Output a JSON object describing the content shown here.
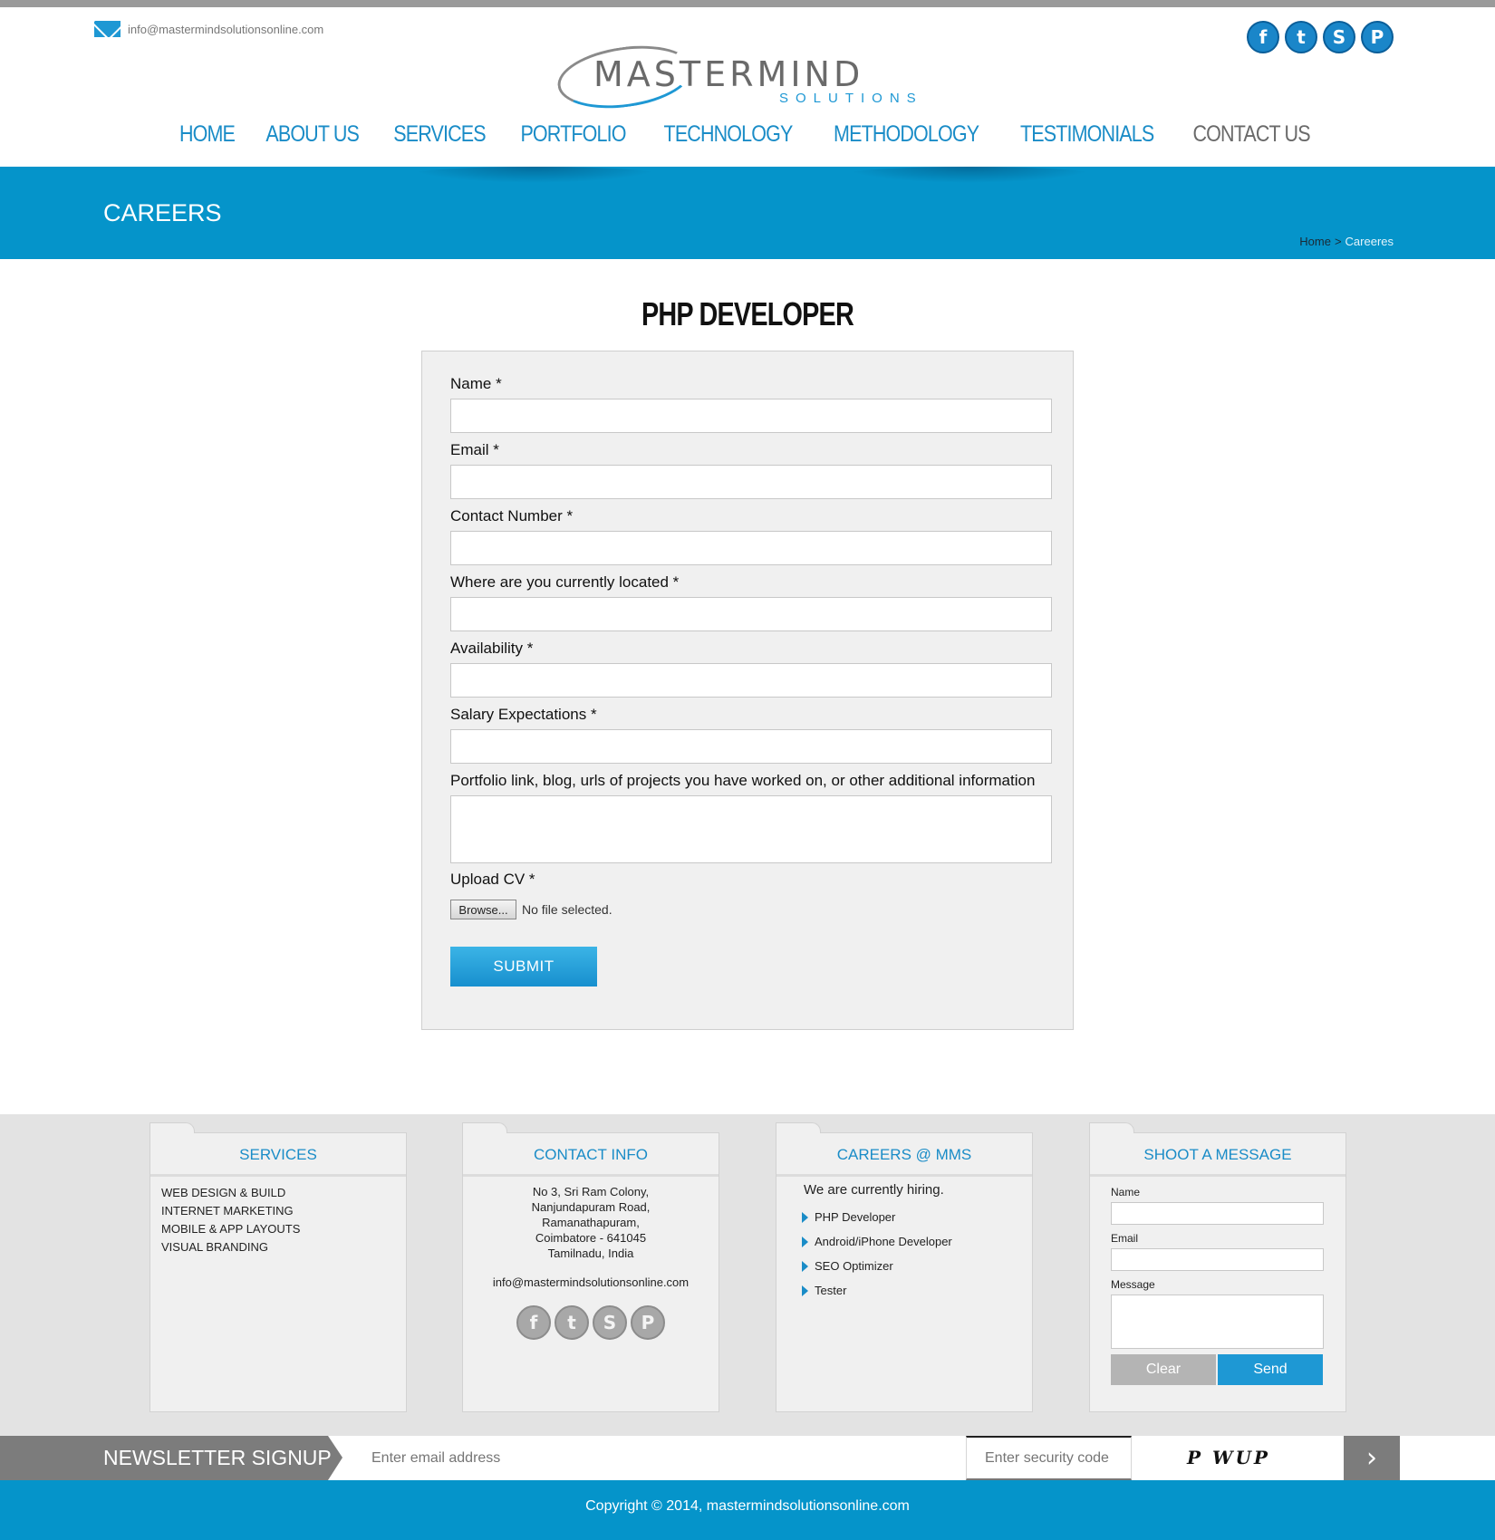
{
  "header": {
    "email": "info@mastermindsolutionsonline.com",
    "logo_main": "MASTERMIND",
    "logo_sub": "SOLUTIONS",
    "social": [
      {
        "icon": "facebook-icon",
        "glyph": "f"
      },
      {
        "icon": "twitter-icon",
        "glyph": "t"
      },
      {
        "icon": "skype-icon",
        "glyph": "S"
      },
      {
        "icon": "pinterest-icon",
        "glyph": "P"
      }
    ]
  },
  "nav": {
    "items": [
      "HOME",
      "ABOUT US",
      "SERVICES",
      "PORTFOLIO",
      "TECHNOLOGY",
      "METHODOLOGY",
      "TESTIMONIALS",
      "CONTACT US"
    ]
  },
  "banner": {
    "title": "CAREERS",
    "crumb_home": "Home",
    "crumb_sep": ">",
    "crumb_current": "Careeres"
  },
  "job": {
    "title": "PHP DEVELOPER",
    "fields": {
      "name": "Name *",
      "email": "Email *",
      "contact": "Contact Number *",
      "location": "Where are you currently located *",
      "availability": "Availability *",
      "salary": "Salary Expectations *",
      "portfolio": "Portfolio link, blog, urls of projects you have worked on, or other additional information",
      "cv": "Upload CV *"
    },
    "browse_label": "Browse...",
    "no_file": "No file selected.",
    "submit_label": "SUBMIT"
  },
  "footer": {
    "services": {
      "title": "SERVICES",
      "items": [
        "WEB DESIGN & BUILD",
        "INTERNET MARKETING",
        "MOBILE & APP LAYOUTS",
        "VISUAL BRANDING"
      ]
    },
    "contact": {
      "title": "CONTACT INFO",
      "address": [
        "No 3, Sri Ram Colony,",
        "Nanjundapuram Road,",
        "Ramanathapuram,",
        "Coimbatore - 641045",
        "Tamilnadu, India"
      ],
      "email": "info@mastermindsolutionsonline.com"
    },
    "careers": {
      "title": "CAREERS @ MMS",
      "intro": "We are currently hiring.",
      "jobs": [
        "PHP Developer",
        "Android/iPhone Developer",
        "SEO Optimizer",
        "Tester"
      ]
    },
    "message": {
      "title": "SHOOT A MESSAGE",
      "name_label": "Name",
      "email_label": "Email",
      "message_label": "Message",
      "clear_label": "Clear",
      "send_label": "Send"
    }
  },
  "newsletter": {
    "label": "NEWSLETTER SIGNUP",
    "email_placeholder": "Enter email address",
    "security_placeholder": "Enter security code",
    "captcha": "P WUP",
    "go_glyph": "›"
  },
  "copyright": "Copyright © 2014, mastermindsolutionsonline.com",
  "colors": {
    "accent": "#0594ca",
    "nav_link": "#1a8cc7",
    "submit": "#178fce"
  }
}
